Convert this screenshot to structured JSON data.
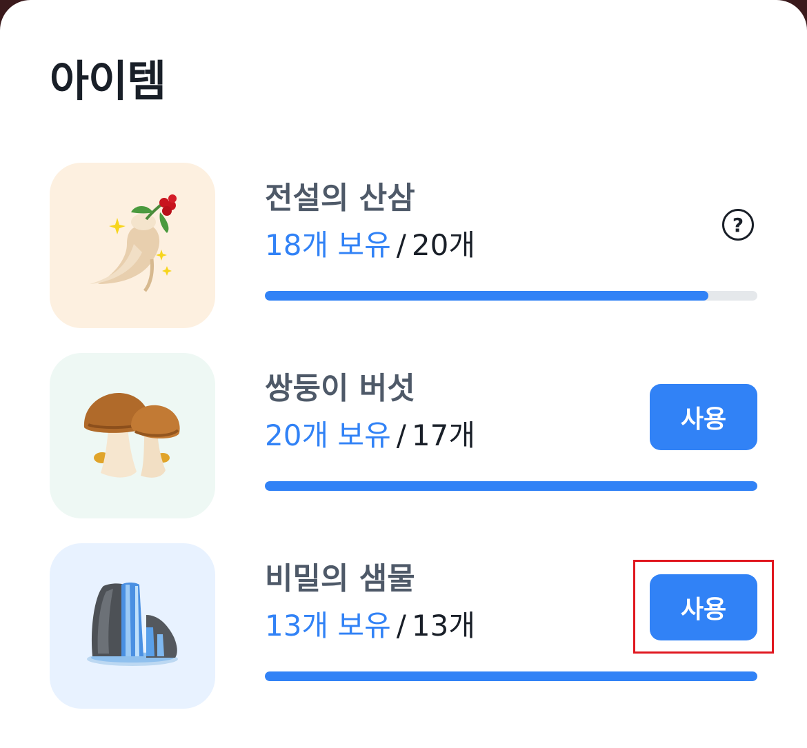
{
  "page": {
    "title": "아이템"
  },
  "items": [
    {
      "name": "전설의 산삼",
      "owned": "18개 보유",
      "separator": "/",
      "goal": "20개",
      "progress": 0.9,
      "action": "help",
      "icon": "ginseng-icon",
      "thumb_color": "#fdf0e0"
    },
    {
      "name": "쌍둥이 버섯",
      "owned": "20개 보유",
      "separator": "/",
      "goal": "17개",
      "progress": 1.0,
      "action": "use",
      "action_label": "사용",
      "icon": "mushroom-icon",
      "thumb_color": "#eef8f4"
    },
    {
      "name": "비밀의 샘물",
      "owned": "13개 보유",
      "separator": "/",
      "goal": "13개",
      "progress": 1.0,
      "action": "use",
      "action_label": "사용",
      "icon": "waterfall-icon",
      "thumb_color": "#e8f2ff"
    }
  ],
  "help_glyph": "?",
  "colors": {
    "accent": "#3182f6",
    "track": "#e5e8eb",
    "highlight": "#e0171f"
  }
}
